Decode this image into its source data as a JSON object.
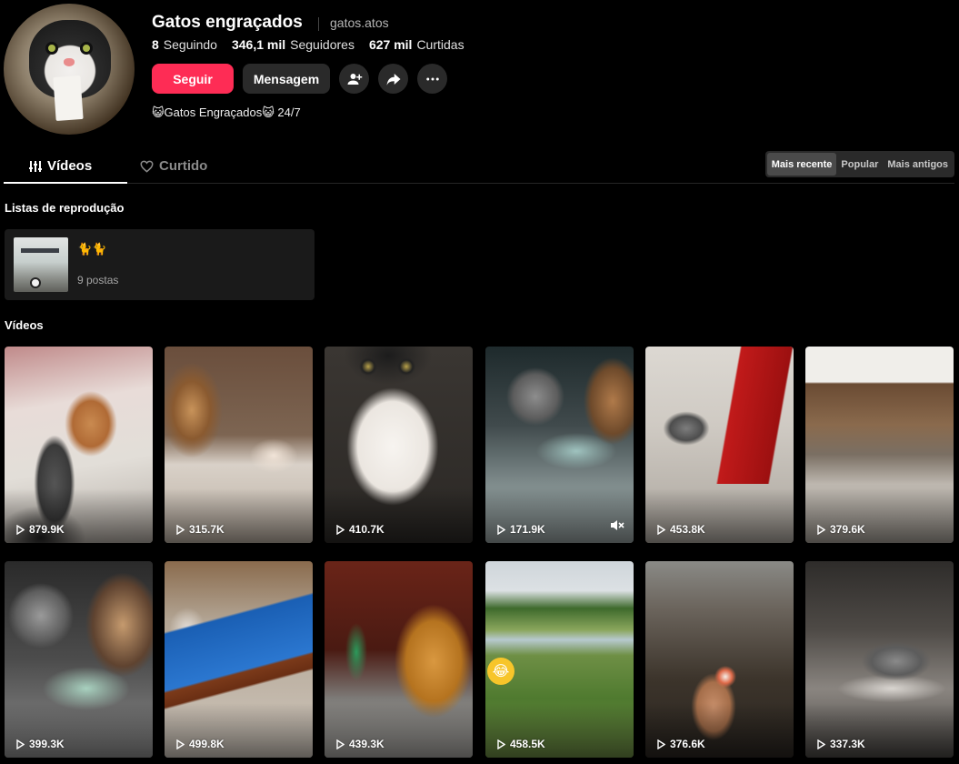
{
  "profile": {
    "display_name": "Gatos engraçados",
    "username": "gatos.atos",
    "following_count": "8",
    "following_label": "Seguindo",
    "followers_count": "346,1 mil",
    "followers_label": "Seguidores",
    "likes_count": "627 mil",
    "likes_label": "Curtidas",
    "bio": "😺Gatos Engraçados😺 24/7"
  },
  "actions": {
    "follow_label": "Seguir",
    "message_label": "Mensagem",
    "accent_color": "#fe2c55"
  },
  "tabs": {
    "videos_label": "Vídeos",
    "liked_label": "Curtido"
  },
  "sort": {
    "options": [
      "Mais recente",
      "Popular",
      "Mais antigos"
    ],
    "selected": "Mais recente"
  },
  "playlists": {
    "title": "Listas de reprodução",
    "items": [
      {
        "name": "🐈🐈",
        "count": "9 postas"
      }
    ]
  },
  "videos": {
    "title": "Vídeos",
    "items": [
      {
        "views": "879.9K",
        "muted": false
      },
      {
        "views": "315.7K",
        "muted": false
      },
      {
        "views": "410.7K",
        "muted": false
      },
      {
        "views": "171.9K",
        "muted": true
      },
      {
        "views": "453.8K",
        "muted": false
      },
      {
        "views": "379.6K",
        "muted": false
      },
      {
        "views": "399.3K",
        "muted": false
      },
      {
        "views": "499.8K",
        "muted": false
      },
      {
        "views": "439.3K",
        "muted": false
      },
      {
        "views": "458.5K",
        "muted": false
      },
      {
        "views": "376.6K",
        "muted": false
      },
      {
        "views": "337.3K",
        "muted": false
      }
    ]
  },
  "icons": {
    "add_friend": "person-add-icon",
    "share": "share-arrow-icon",
    "more": "more-dots-icon",
    "videos_tab": "grid-bars-icon",
    "liked_tab": "heart-outline-icon",
    "play": "play-icon",
    "mute": "mute-icon"
  }
}
